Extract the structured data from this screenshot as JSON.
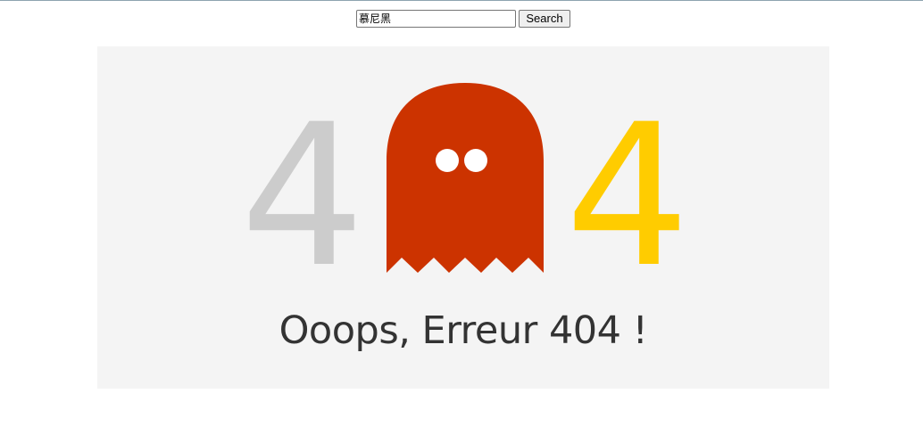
{
  "search": {
    "value": "慕尼黑",
    "button_label": "Search"
  },
  "error": {
    "digit_left": "4",
    "digit_right": "4",
    "message": "Ooops, Erreur 404 !"
  },
  "icons": {
    "ghost": "ghost-icon"
  },
  "colors": {
    "page_background": "#ffffff",
    "panel_background": "#f4f4f4",
    "digit_left": "#cccccc",
    "digit_right": "#ffcc00",
    "ghost_body": "#cc3300",
    "ghost_eyes": "#ffffff",
    "message_text": "#333333"
  }
}
